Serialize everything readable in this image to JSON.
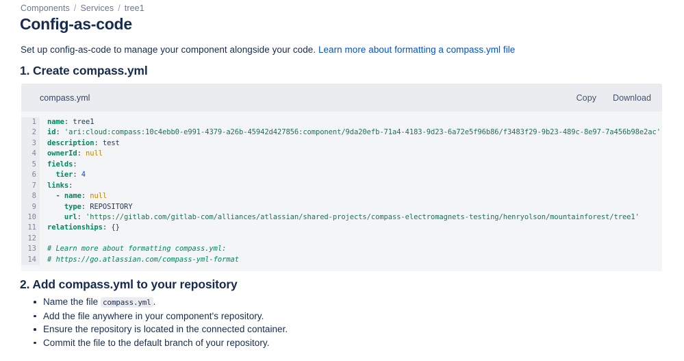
{
  "breadcrumb": {
    "items": [
      {
        "label": "Components"
      },
      {
        "label": "Services"
      },
      {
        "label": "tree1"
      }
    ],
    "separator": "/"
  },
  "header": {
    "title": "Config-as-code"
  },
  "intro": {
    "text": "Set up config-as-code to manage your component alongside your code.",
    "link_text": "Learn more about formatting a compass.yml file",
    "link_color": "#0052CC"
  },
  "sections": {
    "step1_heading": "1. Create compass.yml",
    "step2_heading": "2. Add compass.yml to your repository"
  },
  "code_block": {
    "filename": "compass.yml",
    "copy_label": "Copy",
    "download_label": "Download",
    "line_numbers": [
      "1",
      "2",
      "3",
      "4",
      "5",
      "6",
      "7",
      "8",
      "9",
      "10",
      "11",
      "12",
      "13",
      "14"
    ],
    "lines": [
      "name: tree1",
      "id: 'ari:cloud:compass:10c4ebb0-e991-4379-a26b-45942d427856:component/9da20efb-71a4-4183-9d23-6a72e5f96b86/f3483f29-9b23-489c-8e97-7a456b98e2ac'",
      "description: test",
      "ownerId: null",
      "fields:",
      "  tier: 4",
      "links:",
      "  - name: null",
      "    type: REPOSITORY",
      "    url: 'https://gitlab.com/gitlab-com/alliances/atlassian/shared-projects/compass-electromagnets-testing/henryolson/mountainforest/tree1'",
      "relationships: {}",
      "",
      "# Learn more about formatting compass.yml:",
      "# https://go.atlassian.com/compass-yml-format"
    ],
    "values": {
      "name": "tree1",
      "id": "ari:cloud:compass:10c4ebb0-e991-4379-a26b-45942d427856:component/9da20efb-71a4-4183-9d23-6a72e5f96b86/f3483f29-9b23-489c-8e97-7a456b98e2ac",
      "description": "test",
      "ownerId": "null",
      "tier": "4",
      "link_name": "null",
      "link_type": "REPOSITORY",
      "link_url": "https://gitlab.com/gitlab-com/alliances/atlassian/shared-projects/compass-electromagnets-testing/henryolson/mountainforest/tree1",
      "relationships": "{}",
      "comment_1": "# Learn more about formatting compass.yml:",
      "comment_2": "# https://go.atlassian.com/compass-yml-format"
    },
    "colors": {
      "key": "#00875A",
      "string": "#216E58",
      "null": "#BF8700",
      "number": "#0052CC",
      "comment": "#00875A",
      "background": "#F4F5F7",
      "header_background": "#EBECF0",
      "gutter_background": "#EBECF0",
      "line_number": "#7A869A"
    }
  },
  "steps_list": [
    {
      "text_before": "Name the file ",
      "code": "compass.yml",
      "text_after": "."
    },
    {
      "text_before": "Add the file anywhere in your component's repository.",
      "code": "",
      "text_after": ""
    },
    {
      "text_before": "Ensure the repository is located in the connected container.",
      "code": "",
      "text_after": ""
    },
    {
      "text_before": "Commit the file to the default branch of your repository.",
      "code": "",
      "text_after": ""
    }
  ]
}
